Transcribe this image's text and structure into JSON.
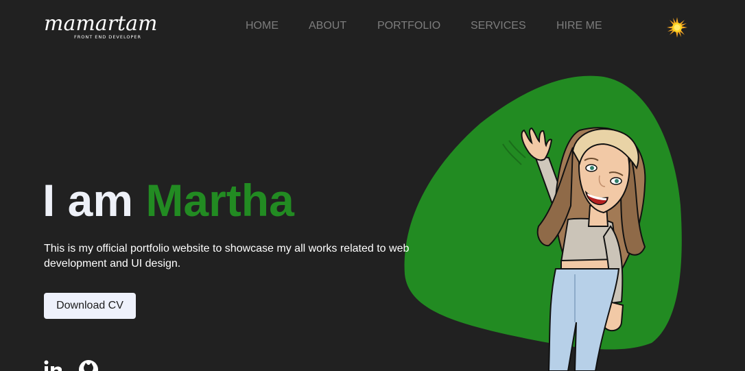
{
  "header": {
    "logo": {
      "wordmark": "mamartam",
      "tagline": "FRONT END DEVELOPER"
    },
    "nav": [
      {
        "label": "HOME"
      },
      {
        "label": "ABOUT"
      },
      {
        "label": "PORTFOLIO"
      },
      {
        "label": "SERVICES"
      },
      {
        "label": "HIRE ME"
      }
    ],
    "theme_toggle_icon": "sun-icon"
  },
  "hero": {
    "greeting": "I am ",
    "name": "Martha",
    "description": "This is my official portfolio website to showcase my all works related to web development and UI design.",
    "download_label": "Download CV"
  },
  "social": [
    {
      "icon": "linkedin-icon"
    },
    {
      "icon": "github-icon"
    }
  ],
  "colors": {
    "background": "#212121",
    "accent": "#228b22",
    "heading": "#eef1f8",
    "nav_text": "#7d7d7d",
    "button_bg": "#eef1fb"
  }
}
